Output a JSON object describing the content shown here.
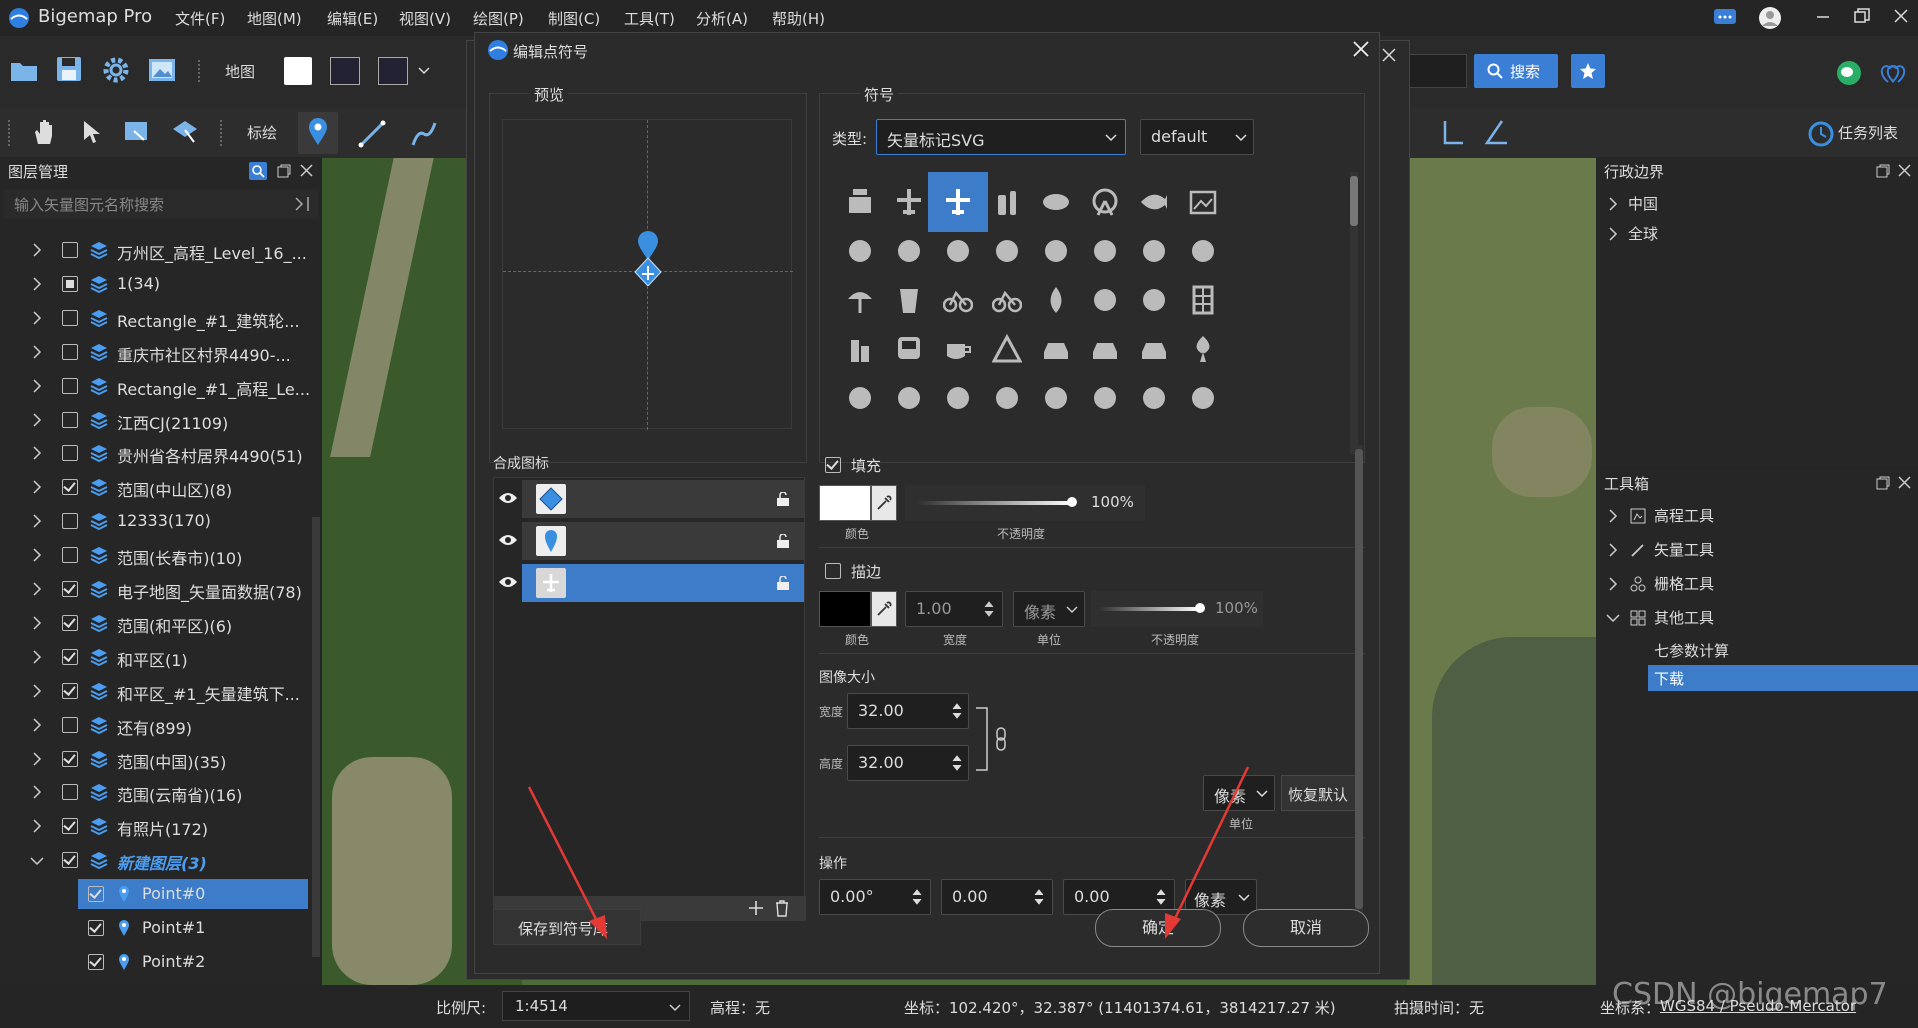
{
  "app": {
    "title": "Bigemap Pro"
  },
  "menu": [
    "文件(F)",
    "地图(M)",
    "编辑(E)",
    "视图(V)",
    "绘图(P)",
    "制图(C)",
    "工具(T)",
    "分析(A)",
    "帮助(H)"
  ],
  "toolbar1": {
    "map_label": "地图",
    "search_label": "搜索"
  },
  "toolbar2": {
    "mark_label": "标绘",
    "task_list": "任务列表"
  },
  "layer_panel": {
    "title": "图层管理",
    "search_placeholder": "输入矢量图元名称搜索",
    "rows": [
      {
        "label": "万州区_高程_Level_16_...",
        "check": "off"
      },
      {
        "label": "1(34)",
        "check": "partial"
      },
      {
        "label": "Rectangle_#1_建筑轮...",
        "check": "off"
      },
      {
        "label": "重庆市社区村界4490-...",
        "check": "off"
      },
      {
        "label": "Rectangle_#1_高程_Le...",
        "check": "off"
      },
      {
        "label": "江西CJ(21109)",
        "check": "off"
      },
      {
        "label": "贵州省各村居界4490(51)",
        "check": "off"
      },
      {
        "label": "范围(中山区)(8)",
        "check": "on"
      },
      {
        "label": "12333(170)",
        "check": "off"
      },
      {
        "label": "范围(长春市)(10)",
        "check": "off"
      },
      {
        "label": "电子地图_矢量面数据(78)",
        "check": "on"
      },
      {
        "label": "范围(和平区)(6)",
        "check": "on"
      },
      {
        "label": "和平区(1)",
        "check": "on"
      },
      {
        "label": "和平区_#1_矢量建筑下...",
        "check": "on"
      },
      {
        "label": "还有(899)",
        "check": "off"
      },
      {
        "label": "范围(中国)(35)",
        "check": "on"
      },
      {
        "label": "范围(云南省)(16)",
        "check": "off"
      },
      {
        "label": "有照片(172)",
        "check": "on"
      },
      {
        "label": "新建图层(3)",
        "check": "on"
      }
    ],
    "points": [
      "Point#0",
      "Point#1",
      "Point#2"
    ]
  },
  "admin_panel": {
    "title": "行政边界",
    "items": [
      "中国",
      "全球"
    ]
  },
  "toolbox": {
    "title": "工具箱",
    "items": [
      "高程工具",
      "矢量工具",
      "栅格工具",
      "其他工具"
    ],
    "sub": [
      "七参数计算",
      "下载"
    ]
  },
  "status": {
    "scale_label": "比例尺:",
    "scale_value": "1:4514",
    "elev": "高程：无",
    "coords": "坐标：102.420°，32.387°  (11401374.61，3814217.27 米)",
    "shot_time": "拍摄时间：无",
    "crs_label": "坐标系：",
    "crs": "WGS84 / Pseudo-Mercator",
    "watermark": "CSDN @bigemap7"
  },
  "dialog": {
    "title": "编辑点符号",
    "preview_label": "预览",
    "symbol_label": "符号",
    "type_label": "类型:",
    "type_value": "矢量标记SVG",
    "style_value": "default",
    "composite_label": "合成图标",
    "fill": {
      "label": "填充",
      "color_label": "颜色",
      "opacity_label": "不透明度",
      "opacity": "100%",
      "opacity_value": 1.0
    },
    "stroke": {
      "label": "描边",
      "color_label": "颜色",
      "width": "1.00",
      "width_label": "宽度",
      "unit": "像素",
      "unit_label": "单位",
      "opacity_label": "不透明度",
      "opacity": "100%",
      "opacity_value": 1.0
    },
    "size": {
      "label": "图像大小",
      "width_label": "宽度",
      "width": "32.00",
      "height_label": "高度",
      "height": "32.00",
      "unit": "像素",
      "unit_label": "单位",
      "reset": "恢复默认"
    },
    "ops": {
      "label": "操作",
      "rotate": "0.00°",
      "dx": "0.00",
      "dy": "0.00",
      "unit": "像素"
    },
    "save_btn": "保存到符号库",
    "ok_btn": "确定",
    "cancel_btn": "取消"
  },
  "colors": {
    "accent": "#3a7fd5",
    "selected": "#3d7cc9"
  }
}
